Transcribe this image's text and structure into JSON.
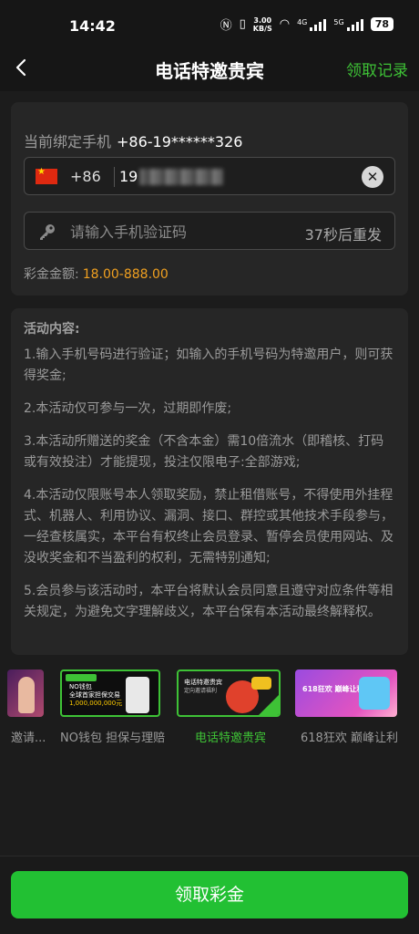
{
  "status_bar": {
    "time": "14:42",
    "net_speed_value": "3.00",
    "net_speed_unit": "KB/S",
    "sig1": "4G",
    "sig2": "5G",
    "battery": "78"
  },
  "nav": {
    "title": "电话特邀贵宾",
    "record": "领取记录"
  },
  "form": {
    "bound_label": "当前绑定手机",
    "bound_phone": "+86-19******326",
    "country_code": "+86",
    "phone_value": "19",
    "code_placeholder": "请输入手机验证码",
    "resend_label": "37秒后重发",
    "amount_label": "彩金金额:",
    "amount_value": "18.00-888.00"
  },
  "rules": {
    "heading": "活动内容:",
    "items": [
      "1.输入手机号码进行验证；如输入的手机号码为特邀用户，则可获得奖金;",
      "2.本活动仅可参与一次，过期即作废;",
      "3.本活动所赠送的奖金（不含本金）需10倍流水（即稽核、打码或有效投注）才能提现，投注仅限电子:全部游戏;",
      "4.本活动仅限账号本人领取奖励，禁止租借账号，不得使用外挂程式、机器人、利用协议、漏洞、接口、群控或其他技术手段参与，一经查核属实，本平台有权终止会员登录、暂停会员使用网站、及没收奖金和不当盈利的权利，无需特别通知;",
      "5.会员参与该活动时，本平台将默认会员同意且遵守对应条件等相关规定，为避免文字理解歧义，本平台保有本活动最终解释权。"
    ]
  },
  "banners": [
    {
      "label": "邀请..."
    },
    {
      "label": "NO钱包 担保与理赔",
      "art": [
        "NO钱包",
        "全球首家担保交易",
        "1,000,000,000元"
      ]
    },
    {
      "label": "电话特邀贵宾",
      "art": [
        "电话特邀贵宾",
        "定向邀请福利"
      ]
    },
    {
      "label": "618狂欢 巅峰让利",
      "art": "618狂欢 巅峰让利"
    }
  ],
  "bottom": {
    "button": "领取彩金"
  },
  "colors": {
    "accent_green": "#22c033",
    "record_green": "#3ec236",
    "amount_orange": "#f0a020",
    "bg": "#1c1c1c",
    "card": "#262626"
  }
}
